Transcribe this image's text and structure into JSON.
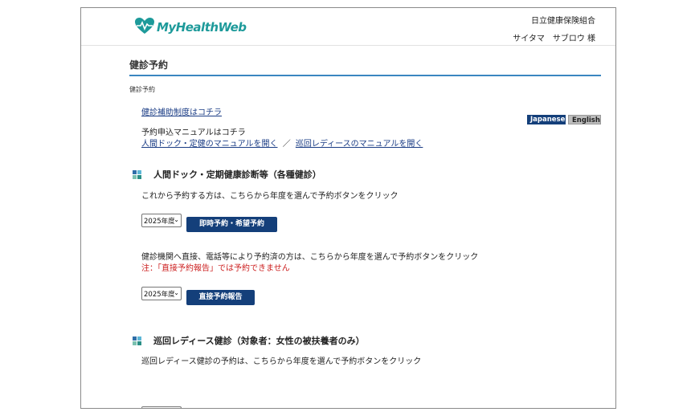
{
  "header": {
    "logo_text": "MyHealthWeb",
    "org_name": "日立健康保険組合",
    "user_name": "サイタマ　サブロウ 様"
  },
  "page": {
    "title": "健診予約",
    "breadcrumb": "健診予約"
  },
  "links": {
    "subsidy": "健診補助制度はコチラ",
    "manual_heading": "予約申込マニュアルはコチラ",
    "manual_dock": "人間ドック・定健のマニュアルを開く",
    "separator": "／",
    "manual_ladies": "巡回レディースのマニュアルを開く"
  },
  "language": {
    "japanese": "Japanese",
    "english": "English"
  },
  "section1": {
    "heading": "人間ドック・定期健康診断等（各種健診）",
    "desc1": "これから予約する方は、こちらから年度を選んで予約ボタンをクリック",
    "year1": "2025年度",
    "button1": "即時予約・希望予約",
    "desc2": "健診機関へ直接、電話等により予約済の方は、こちらから年度を選んで予約ボタンをクリック",
    "note": "注：「直接予約報告」では予約できません",
    "year2": "2025年度",
    "button2": "直接予約報告"
  },
  "section2": {
    "heading": "巡回レディース健診（対象者：女性の被扶養者のみ）",
    "desc": "巡回レディース健診の予約は、こちらから年度を選んで予約ボタンをクリック"
  },
  "colors": {
    "accent": "#143f7a",
    "link": "#1a3c85",
    "note": "#cc1f1f",
    "rule": "#3a86c0",
    "logo": "#1d9a9a"
  }
}
